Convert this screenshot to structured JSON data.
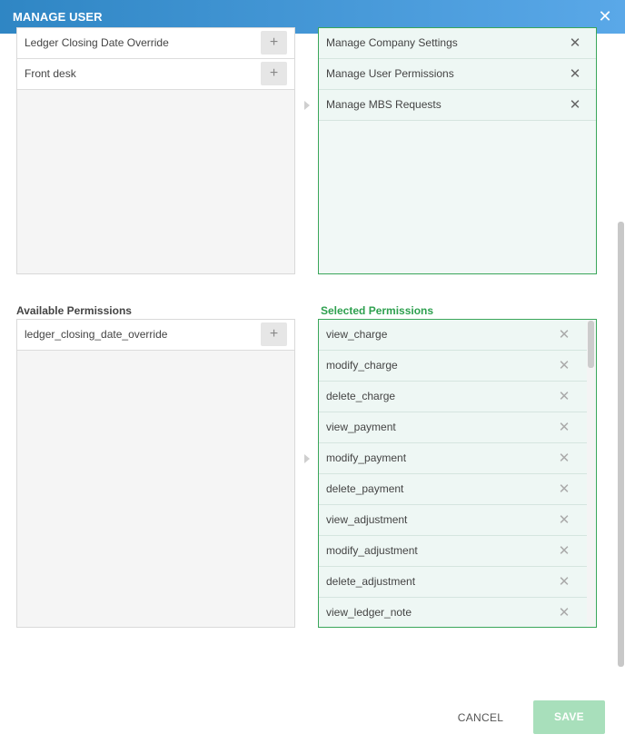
{
  "header": {
    "title": "MANAGE USER",
    "close_icon": "close-icon"
  },
  "roles": {
    "available": [
      {
        "label": "Ledger Closing Date Override"
      },
      {
        "label": "Front desk"
      }
    ],
    "selected": [
      {
        "label": "Manage Company Settings"
      },
      {
        "label": "Manage User Permissions"
      },
      {
        "label": "Manage MBS Requests"
      }
    ]
  },
  "permissions": {
    "available_label": "Available Permissions",
    "selected_label": "Selected Permissions",
    "available": [
      {
        "label": "ledger_closing_date_override"
      }
    ],
    "selected": [
      {
        "label": "view_charge"
      },
      {
        "label": "modify_charge"
      },
      {
        "label": "delete_charge"
      },
      {
        "label": "view_payment"
      },
      {
        "label": "modify_payment"
      },
      {
        "label": "delete_payment"
      },
      {
        "label": "view_adjustment"
      },
      {
        "label": "modify_adjustment"
      },
      {
        "label": "delete_adjustment"
      },
      {
        "label": "view_ledger_note"
      }
    ]
  },
  "symbols": {
    "add": "+",
    "remove": "✕"
  },
  "footer": {
    "cancel_label": "CANCEL",
    "save_label": "SAVE"
  },
  "colors": {
    "header_start": "#2f86c4",
    "header_end": "#5aa8e8",
    "selected_border": "#3aa65a",
    "selected_label": "#2ea04f",
    "save_disabled": "#a8dfbb"
  }
}
